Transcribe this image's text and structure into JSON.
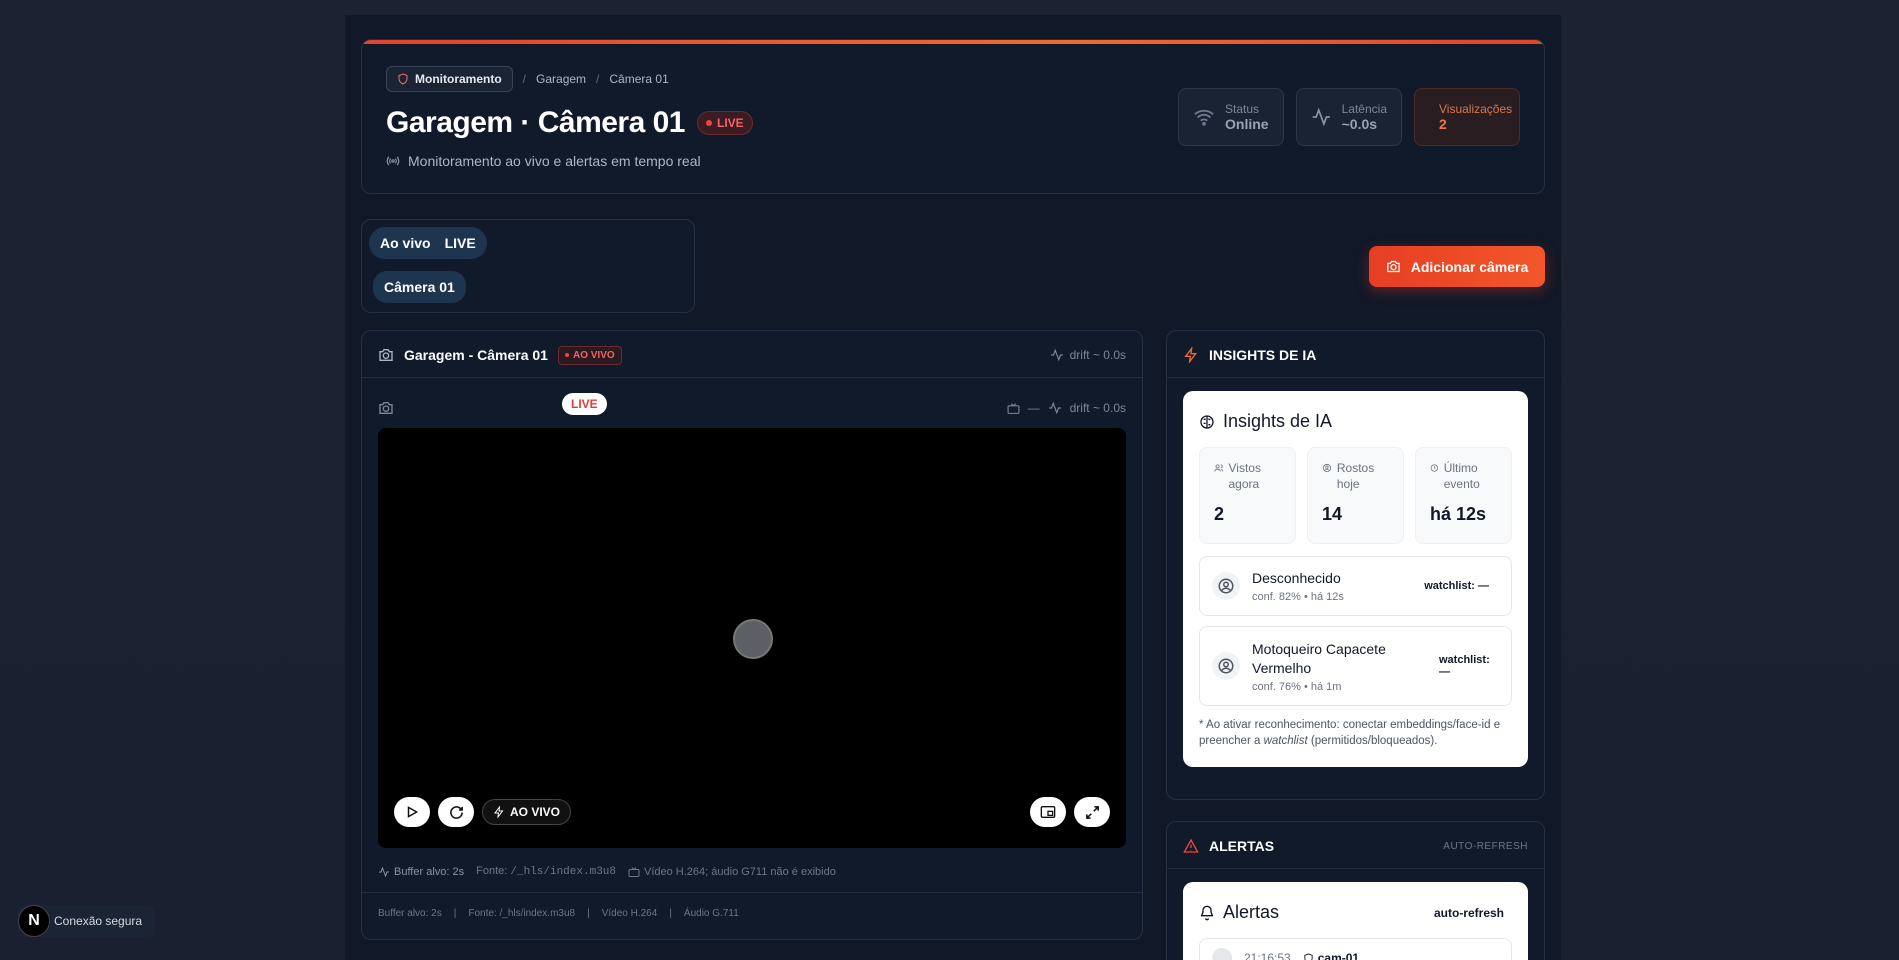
{
  "breadcrumb": {
    "chip": "Monitoramento",
    "items": [
      "Garagem",
      "Câmera 01"
    ],
    "separator": "/"
  },
  "header": {
    "title": "Garagem · Câmera 01",
    "live_badge": "LIVE",
    "subtitle": "Monitoramento ao vivo e alertas em tempo real"
  },
  "stats": [
    {
      "label": "Status",
      "value": "Online",
      "icon": "wifi-icon"
    },
    {
      "label": "Latência",
      "value": "~0.0s",
      "icon": "activity-icon"
    },
    {
      "label": "Visualizações",
      "value": "2",
      "icon": "eye-icon"
    }
  ],
  "tabs": {
    "live_tab": {
      "label": "Ao vivo",
      "badge": "LIVE"
    },
    "camera_tab": {
      "label": "Câmera 01"
    }
  },
  "add_camera_label": "Adicionar câmera",
  "player": {
    "name": "Garagem - Câmera 01",
    "status_tag": "AO VIVO",
    "drift": "drift ~ 0.0s",
    "live_badge": "LIVE",
    "tv_placeholder": "—",
    "drift_inner": "drift ~ 0.0s",
    "aovivo_button": "AO VIVO",
    "meta1": {
      "buffer": "Buffer alvo: 2s",
      "source_label": "Fonte:",
      "source": "/_hls/index.m3u8",
      "codec": "Vídeo H.264; áudio G711 não é exibido"
    },
    "meta2": {
      "buffer": "Buffer alvo: 2s",
      "source": "Fonte: /_hls/index.m3u8",
      "video": "Vídeo H.264",
      "audio": "Áudio G.711",
      "separator": "|"
    }
  },
  "insights": {
    "section_title": "INSIGHTS DE IA",
    "card_title": "Insights de IA",
    "metrics": [
      {
        "label": "Vistos agora",
        "value": "2",
        "icon": "users-icon"
      },
      {
        "label": "Rostos hoje",
        "value": "14",
        "icon": "face-icon"
      },
      {
        "label": "Último evento",
        "value": "há 12s",
        "icon": "clock-icon"
      }
    ],
    "people": [
      {
        "name": "Desconhecido",
        "sub": "conf. 82% • há 12s",
        "watchlist": "watchlist: —"
      },
      {
        "name": "Motoqueiro Capacete Vermelho",
        "sub": "conf. 76% • há 1m",
        "watchlist": "watchlist: —"
      }
    ],
    "note_pre": "* Ao ativar reconhecimento: conectar embeddings/face-id e preencher a",
    "note_em": "watchlist",
    "note_post": "(permitidos/bloqueados)."
  },
  "alerts": {
    "section_title": "ALERTAS",
    "auto_refresh_tag": "AUTO-REFRESH",
    "card_title": "Alertas",
    "auto_refresh": "auto-refresh",
    "rows": [
      {
        "time": "21:16:53",
        "camera": "cam-01"
      }
    ]
  },
  "secure_badge": {
    "logo": "N",
    "label": "Conexão segura"
  },
  "colors": {
    "accent": "#f2572a",
    "live": "#f0443c",
    "bg": "#1c2232"
  }
}
